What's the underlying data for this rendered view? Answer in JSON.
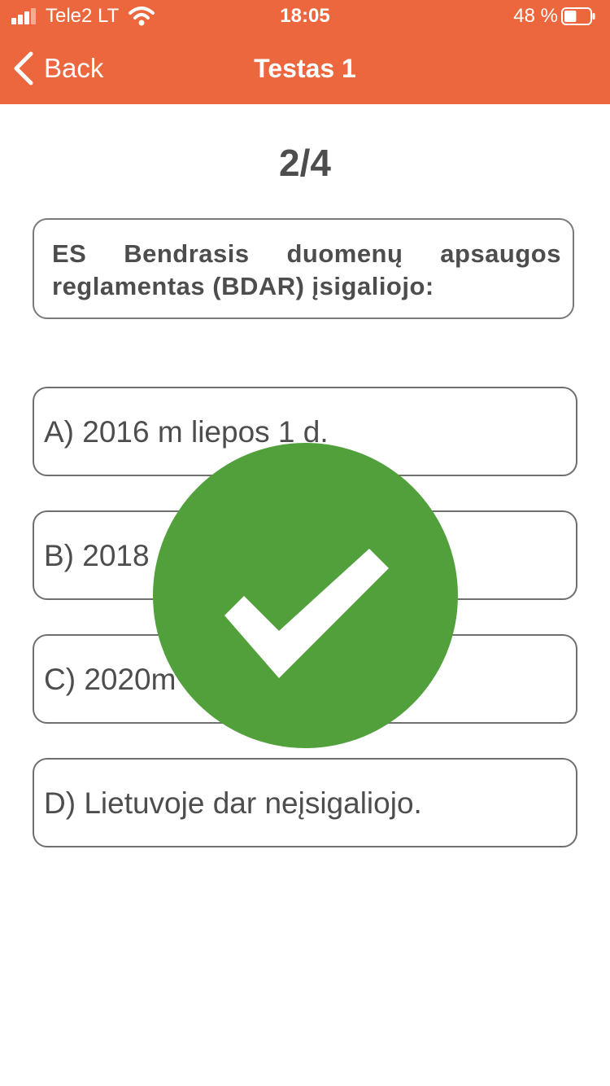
{
  "status_bar": {
    "carrier": "Tele2 LT",
    "time": "18:05",
    "battery_percent": "48 %",
    "battery_level": 0.48,
    "icons": [
      "signal-bars-icon",
      "wifi-icon",
      "battery-icon"
    ]
  },
  "nav_bar": {
    "back_label": "Back",
    "title": "Testas 1"
  },
  "quiz": {
    "progress": "2/4",
    "question": "ES Bendrasis duomenų apsaugos reglamentas (BDAR) įsigaliojo:",
    "answers": [
      {
        "label": "A) 2016 m liepos 1 d."
      },
      {
        "label": "B) 2018"
      },
      {
        "label": "C) 2020m"
      },
      {
        "label": "D) Lietuvoje dar neįsigaliojo."
      }
    ],
    "result_icon": "checkmark-icon"
  },
  "colors": {
    "accent": "#ec673d",
    "correct": "#51a03b",
    "text": "#4d4d4d",
    "border": "#7a7a7a"
  }
}
